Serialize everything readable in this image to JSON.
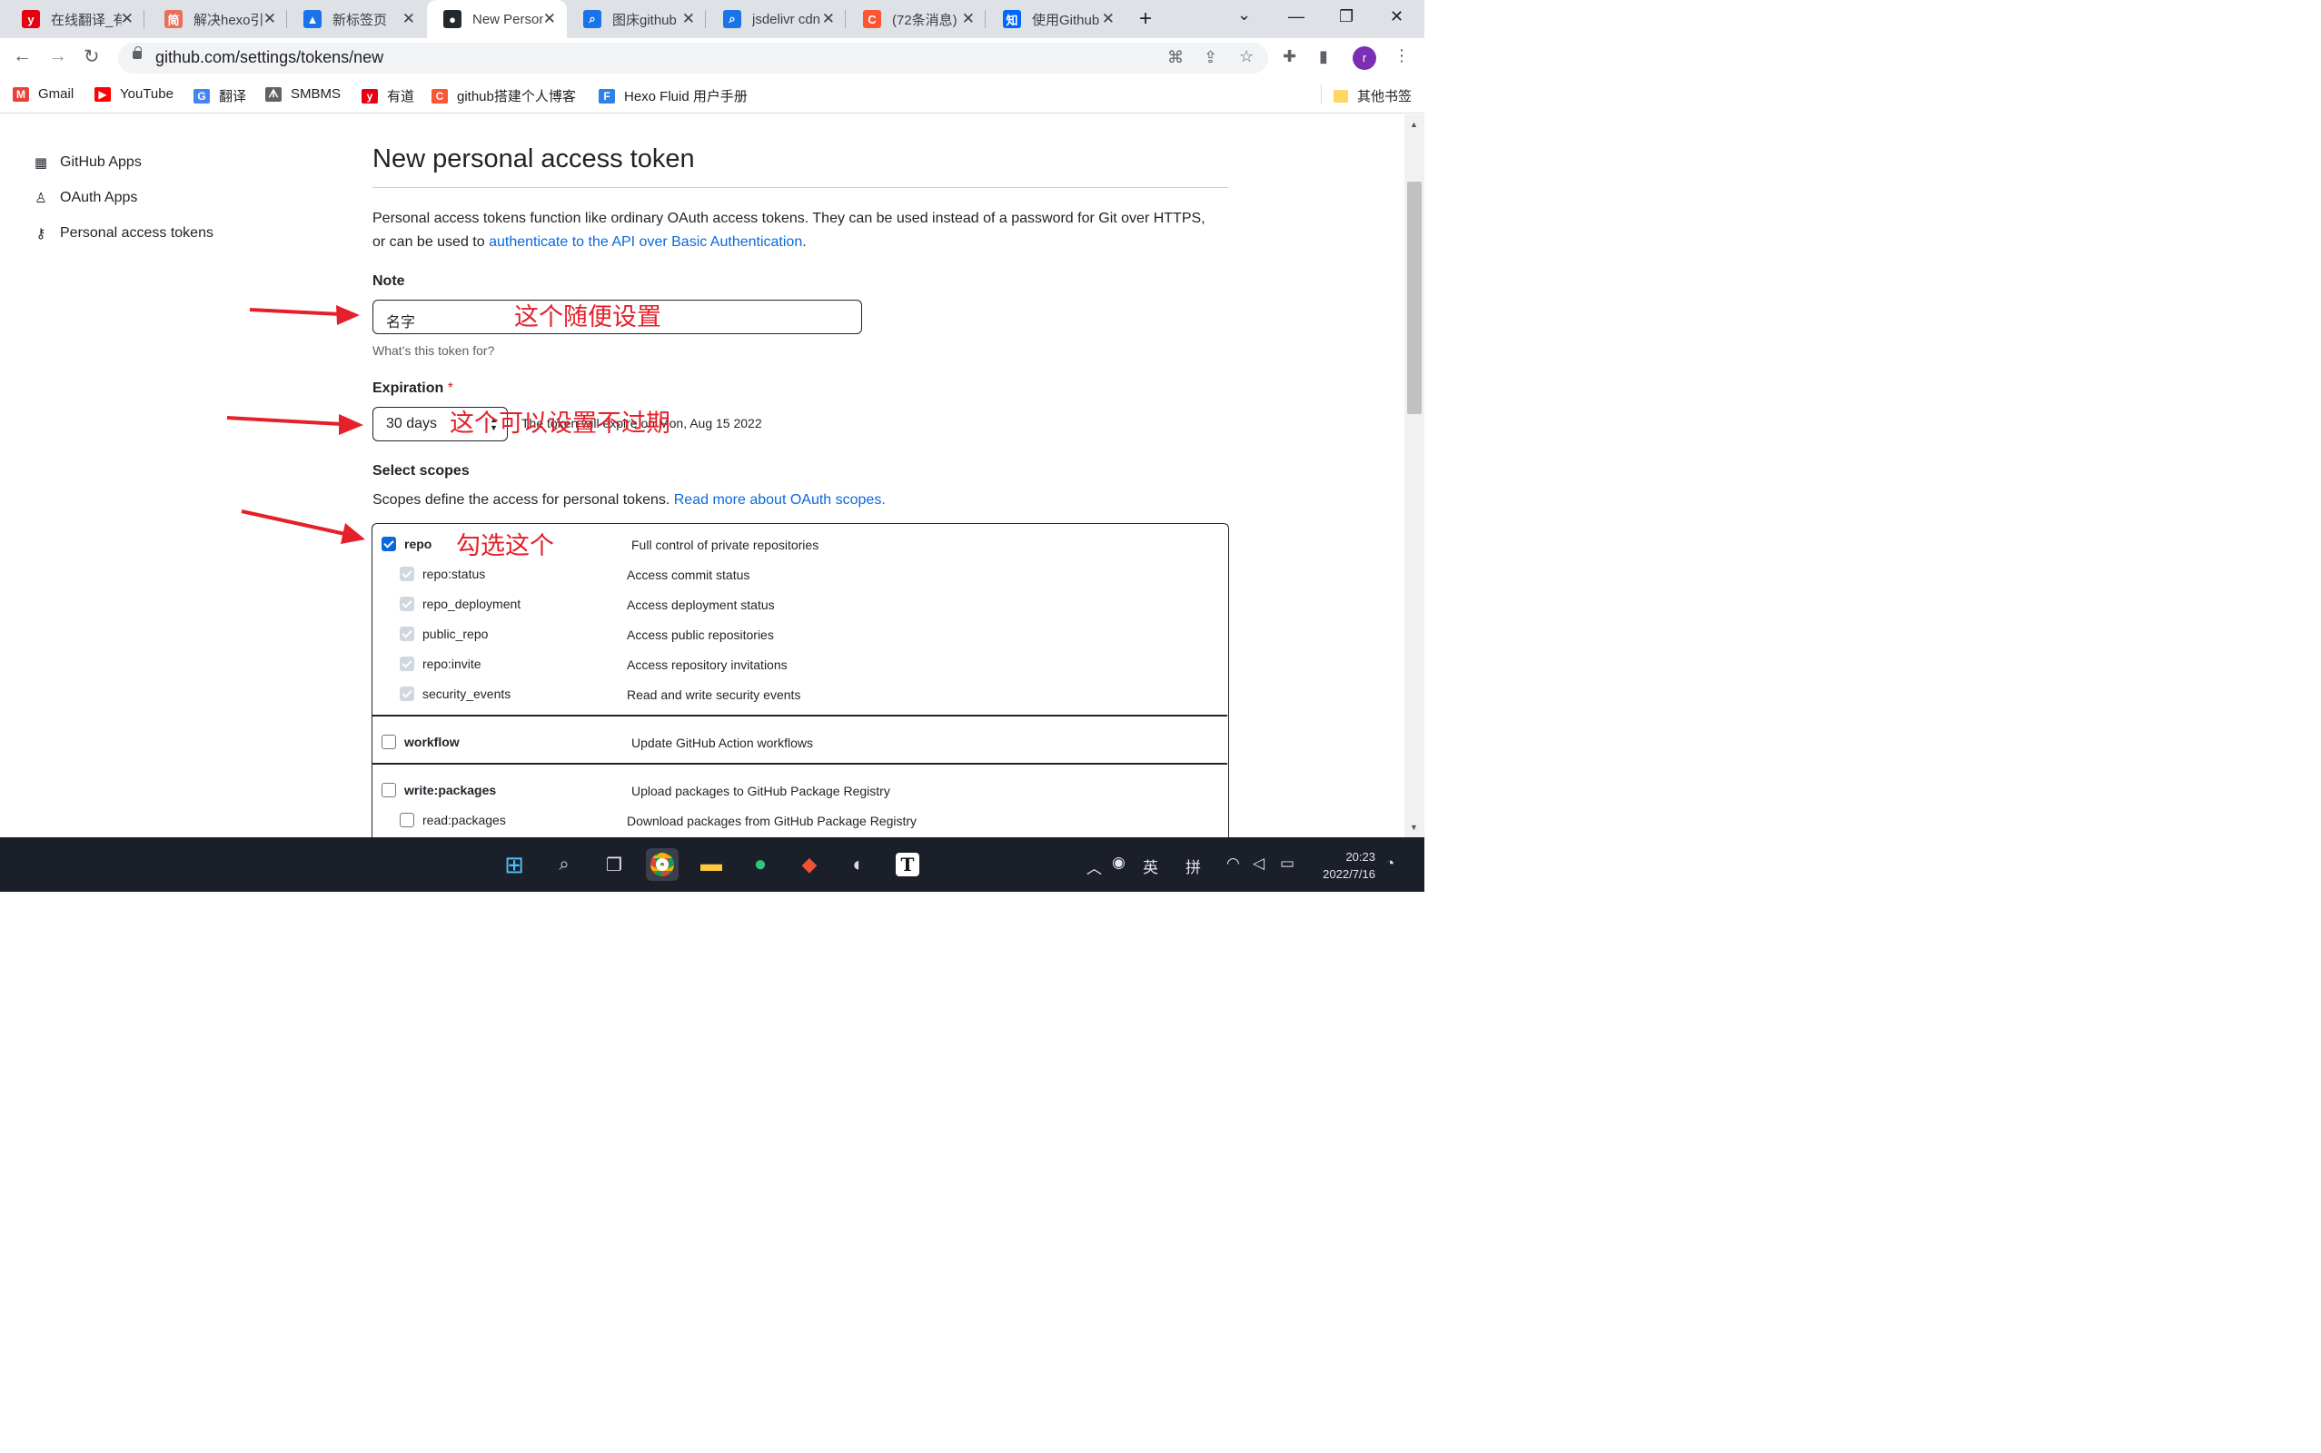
{
  "browser": {
    "tabs": [
      {
        "title": "在线翻译_有道",
        "icon": "youdao-icon",
        "color": "#e60012",
        "glyph": "y",
        "active": false
      },
      {
        "title": "解决hexo引",
        "icon": "jianshu-icon",
        "color": "#ea6f5a",
        "glyph": "简",
        "active": false
      },
      {
        "title": "新标签页",
        "icon": "newtab-icon",
        "color": "#1a73e8",
        "glyph": "▲",
        "active": false
      },
      {
        "title": "New Personal",
        "icon": "github-icon",
        "color": "#24292f",
        "glyph": "●",
        "active": true
      },
      {
        "title": "图床github",
        "icon": "search-icon",
        "color": "#1a73e8",
        "glyph": "⌕",
        "active": false
      },
      {
        "title": "jsdelivr cdn",
        "icon": "search-icon",
        "color": "#1a73e8",
        "glyph": "⌕",
        "active": false
      },
      {
        "title": "(72条消息)",
        "icon": "csdn-icon",
        "color": "#fc5531",
        "glyph": "C",
        "active": false
      },
      {
        "title": "使用Github",
        "icon": "zhihu-icon",
        "color": "#0066ff",
        "glyph": "知",
        "active": false
      }
    ],
    "new_tab_glyph": "+",
    "url": "github.com/settings/tokens/new",
    "profile_initial": "r",
    "bookmarks": [
      {
        "label": "Gmail",
        "icon": "gmail-icon",
        "color": "#ea4335",
        "glyph": "M"
      },
      {
        "label": "YouTube",
        "icon": "youtube-icon",
        "color": "#ff0000",
        "glyph": "▶"
      },
      {
        "label": "翻译",
        "icon": "google-translate-icon",
        "color": "#4285f4",
        "glyph": "G"
      },
      {
        "label": "SMBMS",
        "icon": "smbms-icon",
        "color": "#5f6368",
        "glyph": "ᗑ"
      },
      {
        "label": "有道",
        "icon": "youdao-icon",
        "color": "#e60012",
        "glyph": "y"
      },
      {
        "label": "github搭建个人博客",
        "icon": "csdn-icon",
        "color": "#fc5531",
        "glyph": "C"
      },
      {
        "label": "Hexo Fluid 用户手册",
        "icon": "fluid-icon",
        "color": "#2f80ed",
        "glyph": "F"
      }
    ],
    "other_bookmarks": "其他书签"
  },
  "sidebar": {
    "items": [
      {
        "label": "GitHub Apps",
        "icon": "apps-grid-icon",
        "glyph": "▦"
      },
      {
        "label": "OAuth Apps",
        "icon": "person-icon",
        "glyph": "♙"
      },
      {
        "label": "Personal access tokens",
        "icon": "key-icon",
        "glyph": "⚷"
      }
    ]
  },
  "main": {
    "title": "New personal access token",
    "intro_text": "Personal access tokens function like ordinary OAuth access tokens. They can be used instead of a password for Git over HTTPS, or can be used to ",
    "intro_link": "authenticate to the API over Basic Authentication",
    "intro_end": ".",
    "note_label": "Note",
    "note_value": "名字",
    "note_hint": "What’s this token for?",
    "expiration_label": "Expiration",
    "required_mark": "*",
    "expiration_value": "30 days",
    "expiration_note": "The token will expire on Mon, Aug 15 2022",
    "scopes_label": "Select scopes",
    "scopes_desc": "Scopes define the access for personal tokens. ",
    "scopes_link": "Read more about OAuth scopes.",
    "scopes": [
      {
        "name": "repo",
        "desc": "Full control of private repositories",
        "checked": true,
        "children": [
          {
            "name": "repo:status",
            "desc": "Access commit status"
          },
          {
            "name": "repo_deployment",
            "desc": "Access deployment status"
          },
          {
            "name": "public_repo",
            "desc": "Access public repositories"
          },
          {
            "name": "repo:invite",
            "desc": "Access repository invitations"
          },
          {
            "name": "security_events",
            "desc": "Read and write security events"
          }
        ]
      },
      {
        "name": "workflow",
        "desc": "Update GitHub Action workflows",
        "checked": false,
        "children": []
      },
      {
        "name": "write:packages",
        "desc": "Upload packages to GitHub Package Registry",
        "checked": false,
        "children": [
          {
            "name": "read:packages",
            "desc": "Download packages from GitHub Package Registry",
            "checked": false
          }
        ]
      }
    ]
  },
  "annotations": {
    "note": "这个随便设置",
    "expiration": "这个可以设置不过期",
    "repo": "勾选这个",
    "color": "#e4202a"
  },
  "taskbar": {
    "ime_lang": "英",
    "ime_mode": "拼",
    "time": "20:23",
    "date": "2022/7/16"
  }
}
